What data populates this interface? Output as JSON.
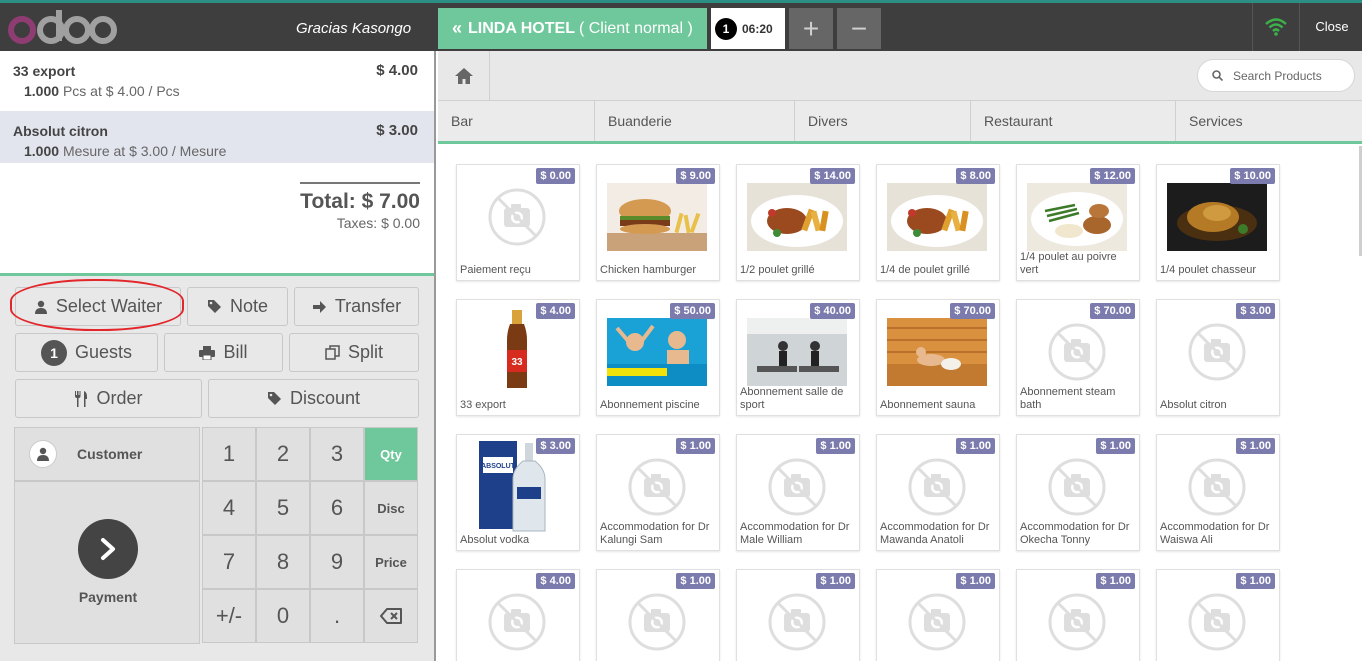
{
  "header": {
    "cashier": "Gracias Kasongo",
    "order_tab": {
      "arrow": "«",
      "label": "LINDA HOTEL",
      "client": "( Client normal )"
    },
    "time_tab": {
      "number": "1",
      "time": "06:20"
    },
    "add_label": "+",
    "remove_label": "−",
    "close_label": "Close",
    "colors": {
      "bar": "#3e3e3e",
      "accent": "#6ec89b",
      "logo_ring": "#8f3c73",
      "logo_letters": "#a0a0a0"
    }
  },
  "order": {
    "lines": [
      {
        "name": "33 export",
        "price": "$ 4.00",
        "qty": "1.000",
        "detail": "Pcs at $ 4.00 / Pcs"
      },
      {
        "name": "Absolut citron",
        "price": "$ 3.00",
        "qty": "1.000",
        "detail": "Mesure at $ 3.00 / Mesure"
      }
    ],
    "total": "Total: $ 7.00",
    "taxes": "Taxes: $ 0.00"
  },
  "controls": {
    "select_waiter": "Select Waiter",
    "note": "Note",
    "transfer": "Transfer",
    "guests_count": "1",
    "guests": "Guests",
    "bill": "Bill",
    "split": "Split",
    "order": "Order",
    "discount": "Discount"
  },
  "keypad": {
    "customer": "Customer",
    "payment": "Payment",
    "keys": [
      [
        "1",
        "2",
        "3"
      ],
      [
        "4",
        "5",
        "6"
      ],
      [
        "7",
        "8",
        "9"
      ],
      [
        "+/-",
        "0",
        "."
      ]
    ],
    "modes": [
      "Qty",
      "Disc",
      "Price"
    ],
    "active_mode": "Qty"
  },
  "products_panel": {
    "search_placeholder": "Search Products",
    "categories": [
      "Bar",
      "Buanderie",
      "Divers",
      "Restaurant",
      "Services"
    ],
    "products": [
      {
        "name": "Paiement reçu",
        "price": "$ 0.00",
        "image": "no-image"
      },
      {
        "name": "Chicken hamburger",
        "price": "$ 9.00",
        "image": "hamburger"
      },
      {
        "name": "1/2 poulet grillé",
        "price": "$ 14.00",
        "image": "grilled-chicken"
      },
      {
        "name": "1/4 de poulet grillé",
        "price": "$ 8.00",
        "image": "grilled-chicken"
      },
      {
        "name": "1/4 poulet au poivre vert",
        "price": "$ 12.00",
        "image": "chicken-pepper"
      },
      {
        "name": "1/4 poulet chasseur",
        "price": "$ 10.00",
        "image": "chicken-chasseur"
      },
      {
        "name": "33 export",
        "price": "$ 4.00",
        "image": "beer-bottle"
      },
      {
        "name": "Abonnement piscine",
        "price": "$ 50.00",
        "image": "pool"
      },
      {
        "name": "Abonnement salle de sport",
        "price": "$ 40.00",
        "image": "gym"
      },
      {
        "name": "Abonnement sauna",
        "price": "$ 70.00",
        "image": "sauna"
      },
      {
        "name": "Abonnement steam bath",
        "price": "$ 70.00",
        "image": "no-image"
      },
      {
        "name": "Absolut citron",
        "price": "$ 3.00",
        "image": "no-image"
      },
      {
        "name": "Absolut vodka",
        "price": "$ 3.00",
        "image": "vodka"
      },
      {
        "name": "Accommodation for Dr Kalungi Sam",
        "price": "$ 1.00",
        "image": "no-image"
      },
      {
        "name": "Accommodation for Dr Male William",
        "price": "$ 1.00",
        "image": "no-image"
      },
      {
        "name": "Accommodation for Dr Mawanda Anatoli",
        "price": "$ 1.00",
        "image": "no-image"
      },
      {
        "name": "Accommodation for Dr Okecha Tonny",
        "price": "$ 1.00",
        "image": "no-image"
      },
      {
        "name": "Accommodation for Dr Waiswa Ali",
        "price": "$ 1.00",
        "image": "no-image"
      },
      {
        "name": "",
        "price": "$ 4.00",
        "image": "no-image"
      },
      {
        "name": "",
        "price": "$ 1.00",
        "image": "no-image"
      },
      {
        "name": "",
        "price": "$ 1.00",
        "image": "no-image"
      },
      {
        "name": "",
        "price": "$ 1.00",
        "image": "no-image"
      },
      {
        "name": "",
        "price": "$ 1.00",
        "image": "no-image"
      },
      {
        "name": "",
        "price": "$ 1.00",
        "image": "no-image"
      }
    ]
  }
}
